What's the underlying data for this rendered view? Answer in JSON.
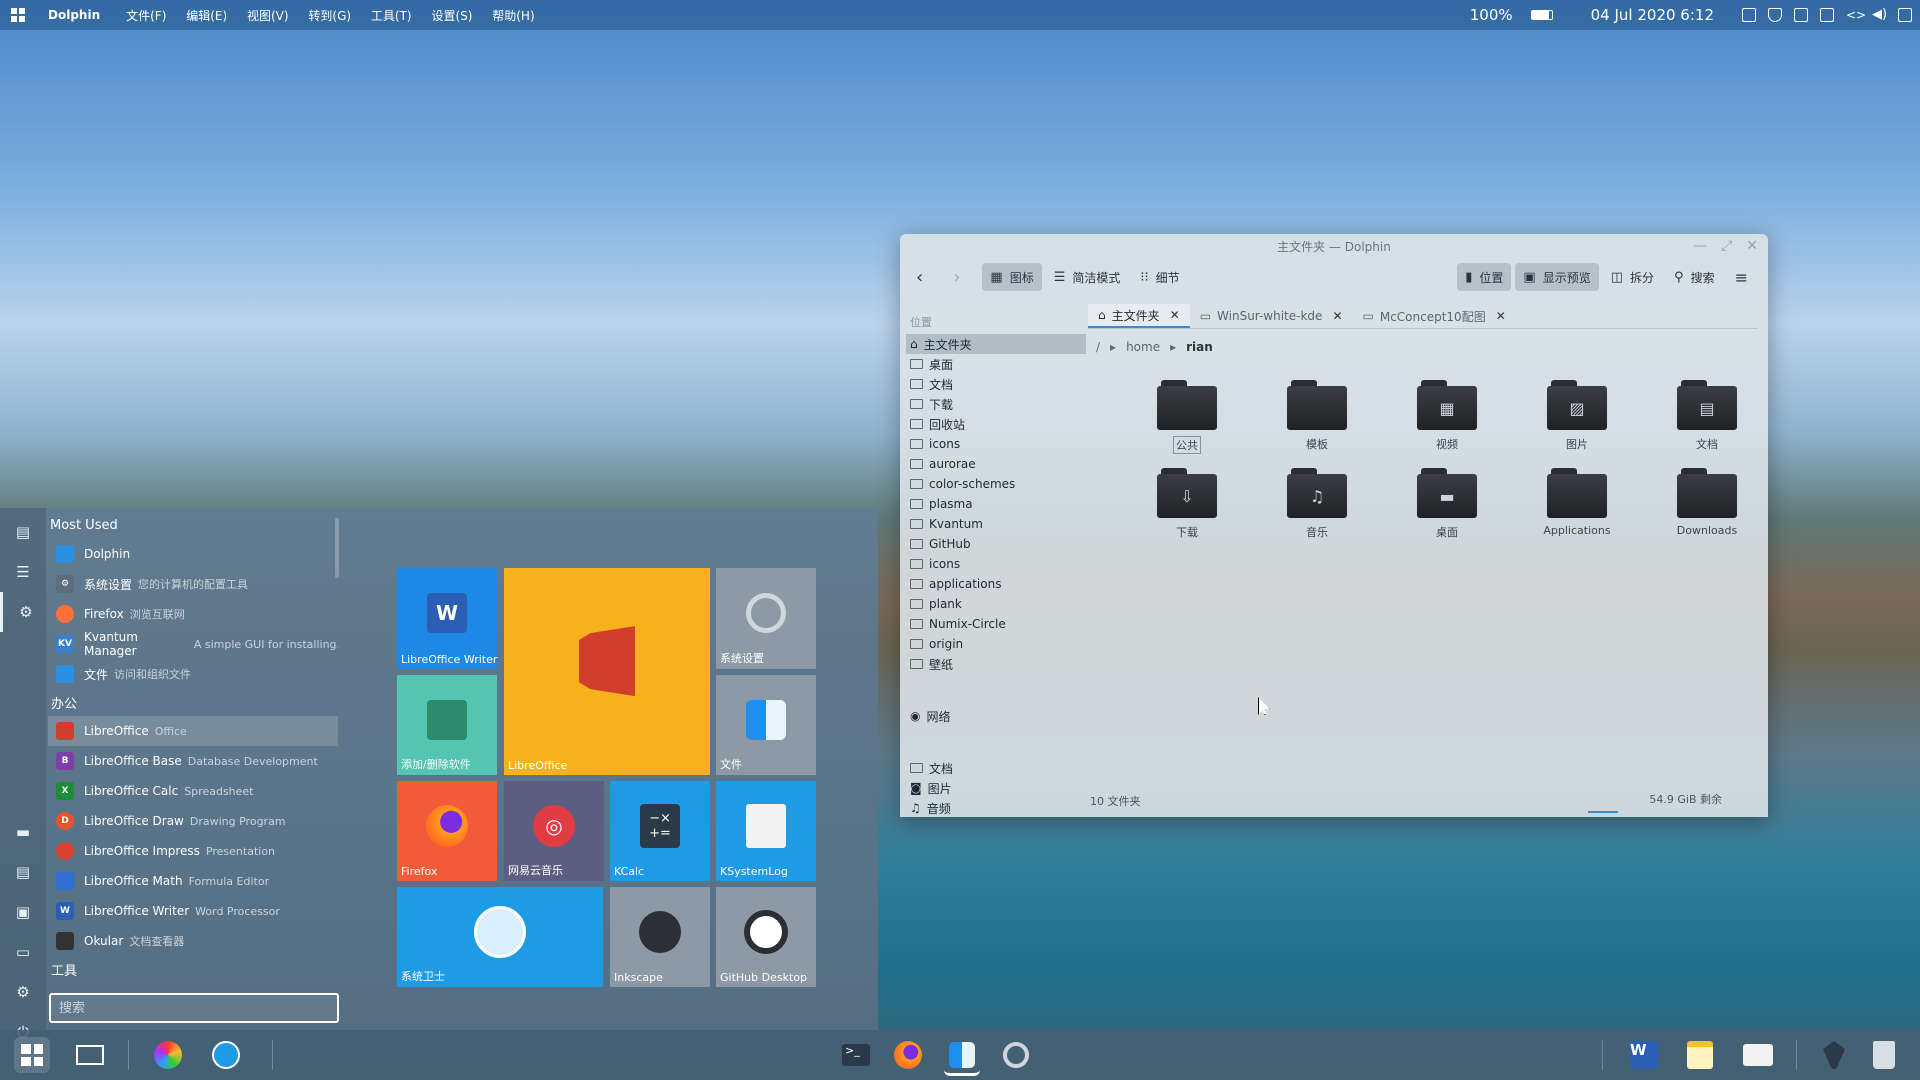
{
  "topbar": {
    "app": "Dolphin",
    "menus": [
      "文件(F)",
      "编辑(E)",
      "视图(V)",
      "转到(G)",
      "工具(T)",
      "设置(S)",
      "帮助(H)"
    ],
    "zoom": "100%",
    "datetime": "04 Jul 2020 6:12"
  },
  "launcher": {
    "most_used_header": "Most Used",
    "most_used": [
      {
        "name": "Dolphin",
        "desc": ""
      },
      {
        "name": "系统设置",
        "desc": "您的计算机的配置工具"
      },
      {
        "name": "Firefox",
        "desc": "浏览互联网"
      },
      {
        "name": "Kvantum Manager",
        "desc": "A simple GUI for installing..."
      },
      {
        "name": "文件",
        "desc": "访问和组织文件"
      }
    ],
    "office_header": "办公",
    "office": [
      {
        "name": "LibreOffice",
        "desc": "Office"
      },
      {
        "name": "LibreOffice Base",
        "desc": "Database Development"
      },
      {
        "name": "LibreOffice Calc",
        "desc": "Spreadsheet"
      },
      {
        "name": "LibreOffice Draw",
        "desc": "Drawing Program"
      },
      {
        "name": "LibreOffice Impress",
        "desc": "Presentation"
      },
      {
        "name": "LibreOffice Math",
        "desc": "Formula Editor"
      },
      {
        "name": "LibreOffice Writer",
        "desc": "Word Processor"
      },
      {
        "name": "Okular",
        "desc": "文档查看器"
      }
    ],
    "tools_header": "工具",
    "search_placeholder": "搜索",
    "tiles": {
      "writer": "LibreOffice Writer",
      "libreoffice": "LibreOffice",
      "settings": "系统设置",
      "addremove": "添加/删除软件",
      "files": "文件",
      "firefox": "Firefox",
      "netease": "网易云音乐",
      "kcalc": "KCalc",
      "ksystemlog": "KSystemLog",
      "guard": "系统卫士",
      "inkscape": "Inkscape",
      "github": "GitHub Desktop"
    }
  },
  "dolphin": {
    "title": "主文件夹 — Dolphin",
    "toolbar": {
      "icons": "图标",
      "compact": "简洁模式",
      "details": "细节",
      "places": "位置",
      "preview": "显示预览",
      "split": "拆分",
      "search": "搜索"
    },
    "places_header": "位置",
    "places": [
      "主文件夹",
      "桌面",
      "文档",
      "下载",
      "回收站",
      "icons",
      "aurorae",
      "color-schemes",
      "plasma",
      "Kvantum",
      "GitHub",
      "icons",
      "applications",
      "plank",
      "Numix-Circle",
      "origin",
      "壁纸"
    ],
    "network": "网络",
    "recent": [
      "文档",
      "图片",
      "音频"
    ],
    "tabs": [
      "主文件夹",
      "WinSur-white-kde",
      "McConcept10配图"
    ],
    "breadcrumb": [
      "/",
      "home",
      "rian"
    ],
    "files": [
      {
        "name": "公共",
        "glyph": ""
      },
      {
        "name": "模板",
        "glyph": ""
      },
      {
        "name": "视频",
        "glyph": "▦"
      },
      {
        "name": "图片",
        "glyph": "▨"
      },
      {
        "name": "文档",
        "glyph": "▤"
      },
      {
        "name": "下载",
        "glyph": "⇩"
      },
      {
        "name": "音乐",
        "glyph": "♫"
      },
      {
        "name": "桌面",
        "glyph": "▬"
      },
      {
        "name": "Applications",
        "glyph": ""
      },
      {
        "name": "Downloads",
        "glyph": ""
      }
    ],
    "status": "10 文件夹",
    "free_space": "54.9 GiB 剩余"
  }
}
